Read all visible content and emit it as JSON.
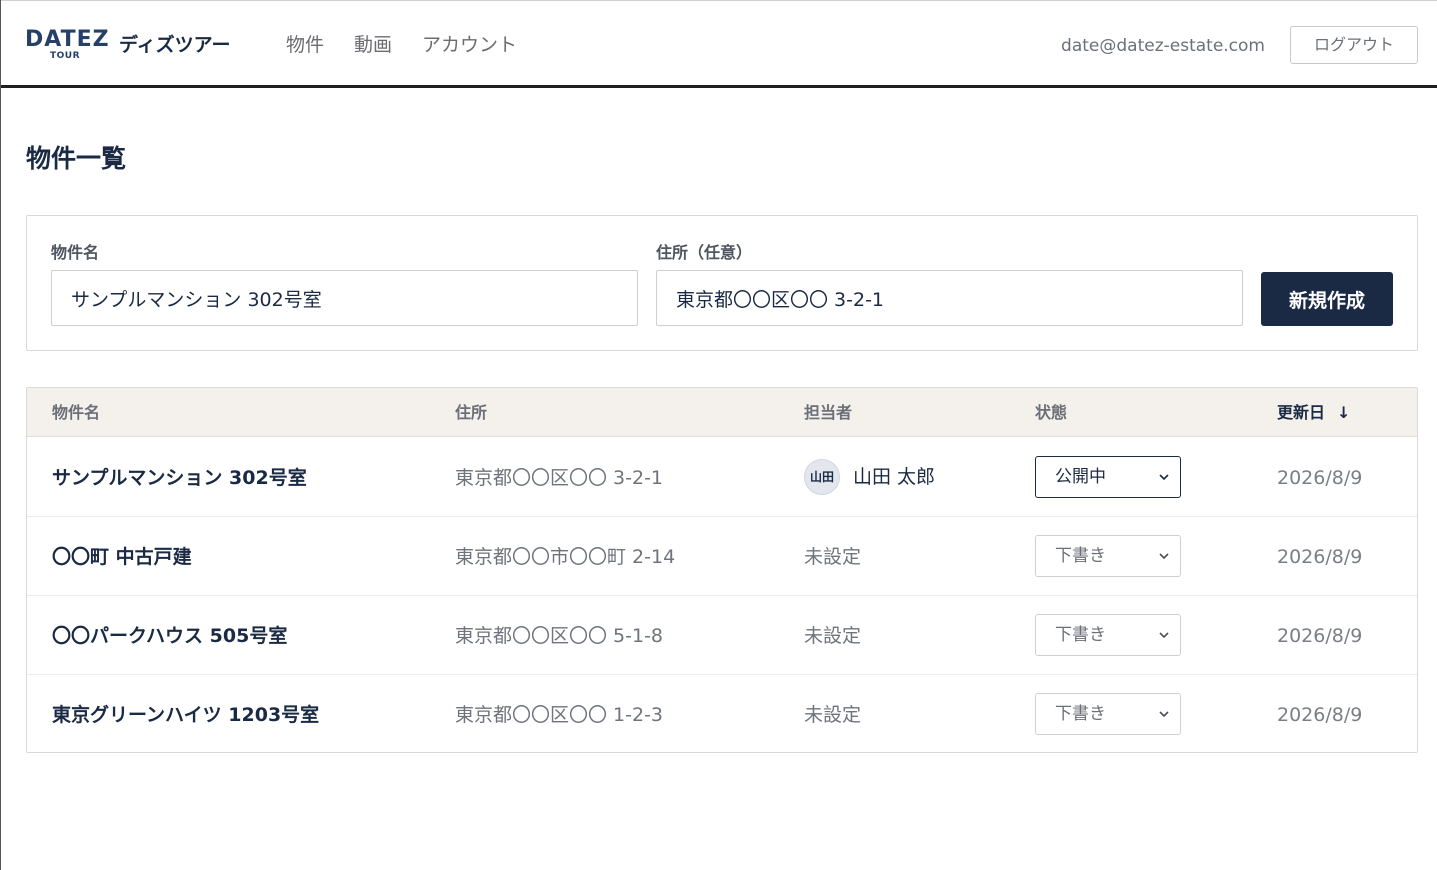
{
  "header": {
    "logo_main": "DATEZ",
    "logo_sub": "TOUR",
    "app_name": "ディズツアー",
    "nav": [
      "物件",
      "動画",
      "アカウント"
    ],
    "user_email": "date@datez-estate.com",
    "logout_label": "ログアウト"
  },
  "page_title": "物件一覧",
  "form": {
    "name_label": "物件名",
    "name_value": "サンプルマンション 302号室",
    "address_label": "住所（任意）",
    "address_value": "東京都〇〇区〇〇 3-2-1",
    "create_label": "新規作成"
  },
  "table": {
    "headers": {
      "name": "物件名",
      "address": "住所",
      "assignee": "担当者",
      "status": "状態",
      "updated": "更新日",
      "sort_icon": "↓"
    },
    "rows": [
      {
        "name": "サンプルマンション 302号室",
        "address": "東京都〇〇区〇〇 3-2-1",
        "assignee_avatar": "山田",
        "assignee": "山田 太郎",
        "status": "公開中",
        "updated": "2026/8/9"
      },
      {
        "name": "〇〇町 中古戸建",
        "address": "東京都〇〇市〇〇町 2-14",
        "assignee": "未設定",
        "status": "下書き",
        "updated": "2026/8/9"
      },
      {
        "name": "〇〇パークハウス 505号室",
        "address": "東京都〇〇区〇〇 5-1-8",
        "assignee": "未設定",
        "status": "下書き",
        "updated": "2026/8/9"
      },
      {
        "name": "東京グリーンハイツ 1203号室",
        "address": "東京都〇〇区〇〇 1-2-3",
        "assignee": "未設定",
        "status": "下書き",
        "updated": "2026/8/9"
      }
    ]
  },
  "colors": {
    "brand": "#1b2a44",
    "logo": "#27406a",
    "table_header_bg": "#f4f1ec"
  }
}
